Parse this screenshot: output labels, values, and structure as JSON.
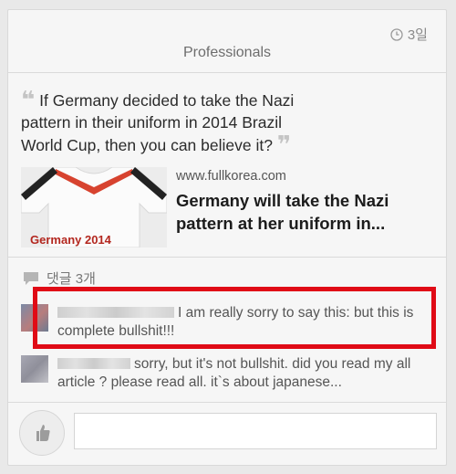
{
  "card": {
    "timestamp": "3일",
    "group_title": "Professionals",
    "quote": "If Germany decided to take the Nazi pattern in their uniform in 2014 Brazil World Cup, then you can believe it?",
    "link": {
      "domain": "www.fullkorea.com",
      "title": "Germany will take the Nazi pattern at her uniform in...",
      "thumbnail_caption": "Germany 2014"
    },
    "comment_count_label": "댓글 3개",
    "comments": [
      {
        "text": "I am really sorry to say this: but this is complete bullshit!!!"
      },
      {
        "text": "sorry, but it's not bullshit. did you read my all article ? please read all. it`s about japanese..."
      }
    ],
    "comment_input": {
      "value": "",
      "placeholder": ""
    }
  },
  "colors": {
    "highlight": "#e00b16",
    "background": "#f6f6f6"
  },
  "icons": {
    "clock": "clock-icon",
    "speech": "speech-bubble-icon",
    "like": "thumbs-up-icon",
    "open_quote": "open-quote-icon",
    "close_quote": "close-quote-icon"
  }
}
